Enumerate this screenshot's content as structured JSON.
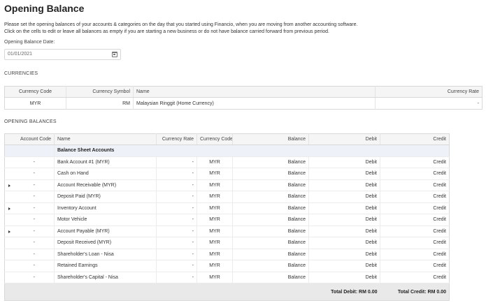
{
  "page": {
    "title": "Opening Balance",
    "intro_line1": "Please set the opening balances of your accounts & categories on the day that you started using Financio, when you are moving from another accounting software.",
    "intro_line2": "Click on the cells to edit or leave all balances as empty if you are starting a new business or do not have balance carried forward from previous period."
  },
  "opening_date": {
    "label": "Opening Balance Date:",
    "value": "01/01/2021",
    "icon": "calendar-icon"
  },
  "currencies": {
    "section_label": "CURRENCIES",
    "headers": {
      "code": "Currency Code",
      "symbol": "Currency Symbol",
      "name": "Name",
      "rate": "Currency Rate"
    },
    "rows": [
      {
        "code": "MYR",
        "symbol": "RM",
        "name": "Malaysian Ringgit (Home Currency)",
        "rate": "-"
      }
    ]
  },
  "balances": {
    "section_label": "OPENING BALANCES",
    "headers": {
      "account_code": "Account Code",
      "name": "Name",
      "rate": "Currency Rate",
      "currency": "Currency Code",
      "balance": "Balance",
      "debit": "Debit",
      "credit": "Credit"
    },
    "group_label": "Balance Sheet Accounts",
    "placeholders": {
      "balance": "Balance",
      "debit": "Debit",
      "credit": "Credit"
    },
    "rows": [
      {
        "code": "-",
        "name": "Bank Account #1 (MYR)",
        "rate": "-",
        "currency": "MYR",
        "expandable": false
      },
      {
        "code": "-",
        "name": "Cash on Hand",
        "rate": "-",
        "currency": "MYR",
        "expandable": false
      },
      {
        "code": "-",
        "name": "Account Receivable (MYR)",
        "rate": "-",
        "currency": "MYR",
        "expandable": true
      },
      {
        "code": "-",
        "name": "Deposit Paid (MYR)",
        "rate": "-",
        "currency": "MYR",
        "expandable": false
      },
      {
        "code": "-",
        "name": "Inventory Account",
        "rate": "-",
        "currency": "MYR",
        "expandable": true
      },
      {
        "code": "-",
        "name": "Motor Vehicle",
        "rate": "-",
        "currency": "MYR",
        "expandable": false
      },
      {
        "code": "-",
        "name": "Account Payable (MYR)",
        "rate": "-",
        "currency": "MYR",
        "expandable": true
      },
      {
        "code": "-",
        "name": "Deposit Received (MYR)",
        "rate": "-",
        "currency": "MYR",
        "expandable": false
      },
      {
        "code": "-",
        "name": "Shareholder's Loan - Nisa",
        "rate": "-",
        "currency": "MYR",
        "expandable": false
      },
      {
        "code": "-",
        "name": "Retained Earnings",
        "rate": "-",
        "currency": "MYR",
        "expandable": false
      },
      {
        "code": "-",
        "name": "Shareholder's Capital - Nisa",
        "rate": "-",
        "currency": "MYR",
        "expandable": false
      }
    ],
    "totals": {
      "debit": "Total Debit: RM 0.00",
      "credit": "Total Credit: RM 0.00"
    }
  }
}
